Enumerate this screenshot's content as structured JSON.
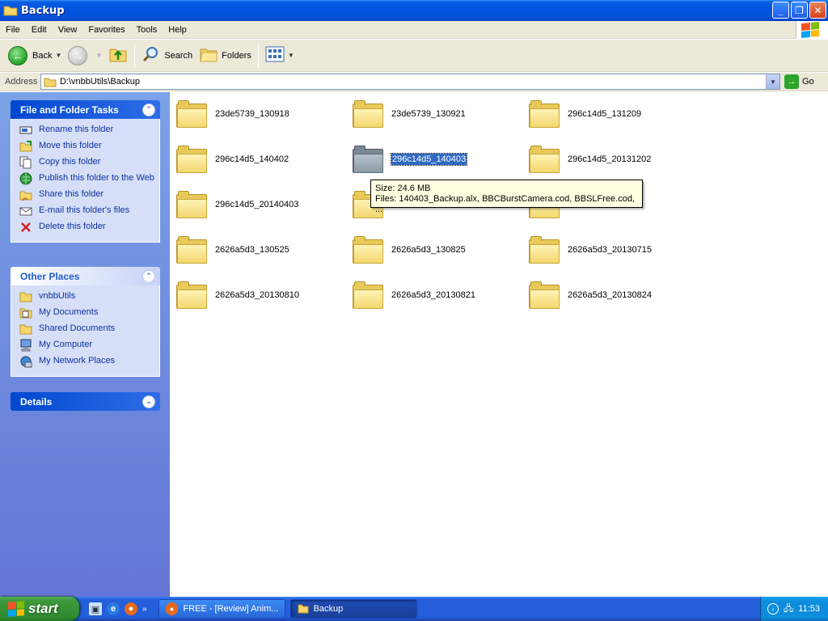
{
  "window": {
    "title": "Backup"
  },
  "menubar": {
    "items": [
      "File",
      "Edit",
      "View",
      "Favorites",
      "Tools",
      "Help"
    ]
  },
  "toolbar": {
    "back_label": "Back",
    "search_label": "Search",
    "folders_label": "Folders"
  },
  "address": {
    "label": "Address",
    "path": "D:\\vnbbUtils\\Backup",
    "go_label": "Go"
  },
  "left_pane": {
    "file_tasks": {
      "title": "File and Folder Tasks",
      "items": [
        {
          "label": "Rename this folder",
          "icon": "rename-icon"
        },
        {
          "label": "Move this folder",
          "icon": "move-icon"
        },
        {
          "label": "Copy this folder",
          "icon": "copy-icon"
        },
        {
          "label": "Publish this folder to the Web",
          "icon": "publish-web-icon"
        },
        {
          "label": "Share this folder",
          "icon": "share-icon"
        },
        {
          "label": "E-mail this folder's files",
          "icon": "email-icon"
        },
        {
          "label": "Delete this folder",
          "icon": "delete-icon"
        }
      ]
    },
    "other_places": {
      "title": "Other Places",
      "items": [
        {
          "label": "vnbbUtils",
          "icon": "folder-icon"
        },
        {
          "label": "My Documents",
          "icon": "my-documents-icon"
        },
        {
          "label": "Shared Documents",
          "icon": "folder-icon"
        },
        {
          "label": "My Computer",
          "icon": "my-computer-icon"
        },
        {
          "label": "My Network Places",
          "icon": "network-places-icon"
        }
      ]
    },
    "details": {
      "title": "Details"
    }
  },
  "folders": [
    "23de5739_130918",
    "23de5739_130921",
    "296c14d5_131209",
    "296c14d5_140402",
    "296c14d5_140403",
    "296c14d5_20131202",
    "296c14d5_20140403",
    "",
    "",
    "2626a5d3_130525",
    "2626a5d3_130825",
    "2626a5d3_20130715",
    "2626a5d3_20130810",
    "2626a5d3_20130821",
    "2626a5d3_20130824"
  ],
  "selected_folder": "296c14d5_140403",
  "tooltip": {
    "size": "Size: 24.6 MB",
    "files": "Files: 140403_Backup.alx, BBCBurstCamera.cod, BBSLFree.cod, ..."
  },
  "taskbar": {
    "start_label": "start",
    "tasks": [
      {
        "label": "FREE - [Review] Anim..."
      },
      {
        "label": "Backup"
      }
    ],
    "clock": "11:53"
  },
  "colors": {
    "title_bar": "#0054e3",
    "left_pane": "#6375d6",
    "selection": "#316ac5",
    "start_button": "#3c9a3c"
  }
}
